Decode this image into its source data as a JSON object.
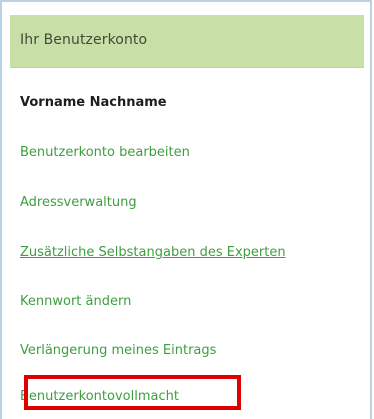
{
  "account_panel": {
    "title": "Ihr Benutzerkonto",
    "user_name": "Vorname Nachname",
    "menu": [
      {
        "label": "Benutzerkonto bearbeiten"
      },
      {
        "label": "Adressverwaltung"
      },
      {
        "label": "Zusätzliche Selbstangaben des Experten"
      },
      {
        "label": "Kennwort ändern"
      },
      {
        "label": "Verlängerung meines Eintrags"
      },
      {
        "label": "Benutzerkontovollmacht"
      }
    ]
  },
  "colors": {
    "header_bg": "#c8dfa8",
    "link": "#3f9e3f",
    "border": "#b9d2e6",
    "highlight": "#e00000"
  }
}
